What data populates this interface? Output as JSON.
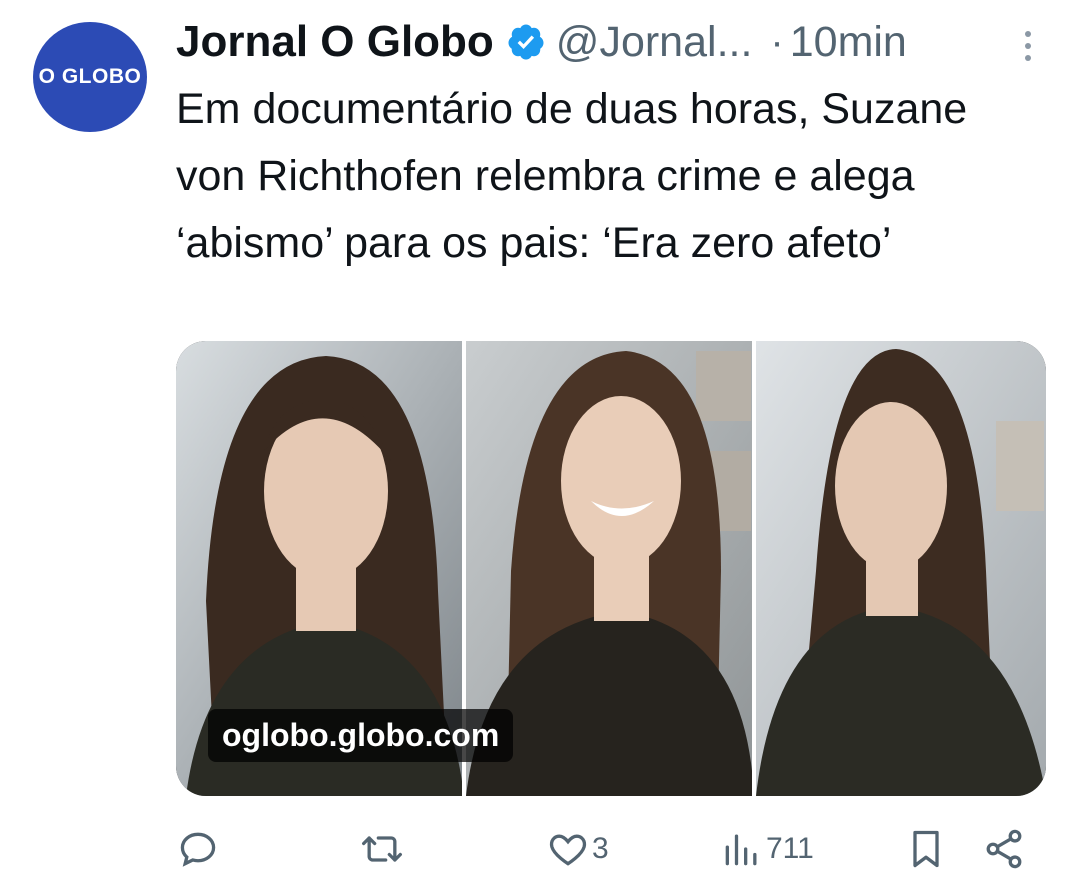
{
  "account": {
    "avatar_text": "O GLOBO",
    "name": "Jornal O Globo",
    "handle": "@Jornal...",
    "separator": "·",
    "time": "10min",
    "verified_icon": "verified-badge-icon",
    "brand_color": "#2c4bb5"
  },
  "post": {
    "text": "Em documentário de duas horas, Suzane von Richthofen relembra crime e alega ‘abismo’ para os pais: ‘Era zero afeto’"
  },
  "media": {
    "link_domain": "oglobo.globo.com",
    "panels": 3
  },
  "actions": {
    "reply": {
      "icon": "reply-icon",
      "count": ""
    },
    "repost": {
      "icon": "repost-icon",
      "count": ""
    },
    "like": {
      "icon": "heart-icon",
      "count": "3"
    },
    "views": {
      "icon": "views-icon",
      "count": "711"
    },
    "bookmark": {
      "icon": "bookmark-icon"
    },
    "share": {
      "icon": "share-icon"
    }
  },
  "colors": {
    "text": "#0f1419",
    "secondary": "#536471",
    "verified": "#1d9bf0"
  }
}
